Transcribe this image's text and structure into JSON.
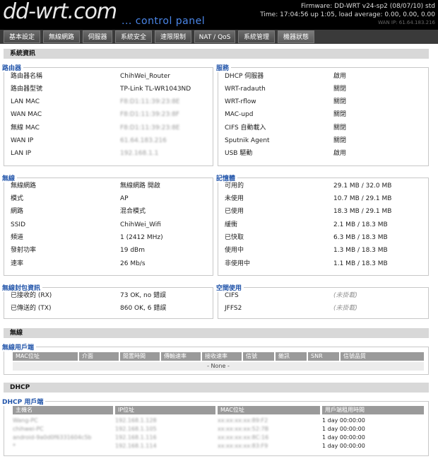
{
  "header": {
    "logo": "dd-wrt.com",
    "subtitle": "... control panel",
    "firmware": "Firmware: DD-WRT v24-sp2 (08/07/10) std",
    "time": "Time: 17:04:56 up 1:05, load average: 0.00, 0.00, 0.00",
    "wan": "WAN IP: 61.64.183.216"
  },
  "tabs": [
    {
      "label": "基本設定"
    },
    {
      "label": "無線網路"
    },
    {
      "label": "伺服器"
    },
    {
      "label": "系統安全"
    },
    {
      "label": "速限限制"
    },
    {
      "label": "NAT / QoS"
    },
    {
      "label": "系統管理"
    },
    {
      "label": "機器狀態"
    }
  ],
  "system_info": {
    "title": "系統資訊",
    "router": {
      "legend": "路由器",
      "rows": [
        {
          "label": "路由器名稱",
          "value": "ChihWei_Router"
        },
        {
          "label": "路由器型號",
          "value": "TP-Link TL-WR1043ND"
        },
        {
          "label": "LAN MAC",
          "value": "F8:D1:11:39:23:8E"
        },
        {
          "label": "WAN MAC",
          "value": "F8:D1:11:39:23:8F"
        },
        {
          "label": "無線 MAC",
          "value": "F8:D1:11:39:23:8E"
        },
        {
          "label": "WAN IP",
          "value": "61.64.183.216"
        },
        {
          "label": "LAN IP",
          "value": "192.168.1.1"
        }
      ]
    },
    "services": {
      "legend": "服務",
      "rows": [
        {
          "label": "DHCP 伺服器",
          "value": "啟用"
        },
        {
          "label": "WRT-radauth",
          "value": "關閉"
        },
        {
          "label": "WRT-rflow",
          "value": "關閉"
        },
        {
          "label": "MAC-upd",
          "value": "關閉"
        },
        {
          "label": "CIFS 自動載入",
          "value": "關閉"
        },
        {
          "label": "Sputnik Agent",
          "value": "關閉"
        },
        {
          "label": "USB 驅動",
          "value": "啟用"
        }
      ]
    },
    "wireless": {
      "legend": "無線",
      "rows": [
        {
          "label": "無線網路",
          "value": "無線網路 開啟"
        },
        {
          "label": "模式",
          "value": "AP"
        },
        {
          "label": "網路",
          "value": "混合模式"
        },
        {
          "label": "SSID",
          "value": "ChihWei_Wifi"
        },
        {
          "label": "頻道",
          "value": "1 (2412 MHz)"
        },
        {
          "label": "發射功率",
          "value": "19 dBm"
        },
        {
          "label": "速率",
          "value": "26 Mb/s"
        }
      ]
    },
    "memory": {
      "legend": "記憶體",
      "rows": [
        {
          "label": "可用的",
          "value": "29.1 MB / 32.0 MB",
          "fraction": 0.909
        },
        {
          "label": "未使用",
          "value": "10.7 MB / 29.1 MB",
          "fraction": 0.368
        },
        {
          "label": "已使用",
          "value": "18.3 MB / 29.1 MB",
          "fraction": 0.629
        },
        {
          "label": "緩衝",
          "value": "2.1 MB / 18.3 MB",
          "fraction": 0.115
        },
        {
          "label": "已快取",
          "value": "6.3 MB / 18.3 MB",
          "fraction": 0.344
        },
        {
          "label": "使用中",
          "value": "1.3 MB / 18.3 MB",
          "fraction": 0.071
        },
        {
          "label": "非使用中",
          "value": "1.1 MB / 18.3 MB",
          "fraction": 0.06
        }
      ]
    },
    "packets": {
      "legend": "無線封包資訊",
      "rows": [
        {
          "label": "已接收的 (RX)",
          "value": "73 OK, no 錯誤"
        },
        {
          "label": "已傳送的 (TX)",
          "value": "860 OK, 6 錯誤"
        }
      ]
    },
    "space": {
      "legend": "空間使用",
      "rows": [
        {
          "label": "CIFS",
          "value": "(未掛載)"
        },
        {
          "label": "JFFS2",
          "value": "(未掛載)"
        }
      ]
    }
  },
  "wireless_section": {
    "title": "無線",
    "legend": "無線用戶端",
    "columns": [
      "MAC位址",
      "介面",
      "閒置時間",
      "傳輸速率",
      "接收速率",
      "信號",
      "雜訊",
      "SNR",
      "信號品質"
    ],
    "empty": "- None -"
  },
  "dhcp_section": {
    "title": "DHCP",
    "legend": "DHCP 用戶端",
    "columns": [
      "主機名",
      "IP位址",
      "MAC位址",
      "用戶端租用時間"
    ],
    "rows": [
      {
        "host": "Wang-PC",
        "ip": "192.168.1.128",
        "mac": "xx:xx:xx:xx:89:F2",
        "lease": "1 day 00:00:00"
      },
      {
        "host": "chihwei-PC",
        "ip": "192.168.1.105",
        "mac": "xx:xx:xx:xx:52:7B",
        "lease": "1 day 00:00:00"
      },
      {
        "host": "android-9a0d0f6331604c5b",
        "ip": "192.168.1.116",
        "mac": "xx:xx:xx:xx:8C:16",
        "lease": "1 day 00:00:00"
      },
      {
        "host": "*",
        "ip": "192.168.1.114",
        "mac": "xx:xx:xx:xx:83:F9",
        "lease": "1 day 00:00:00"
      }
    ]
  }
}
